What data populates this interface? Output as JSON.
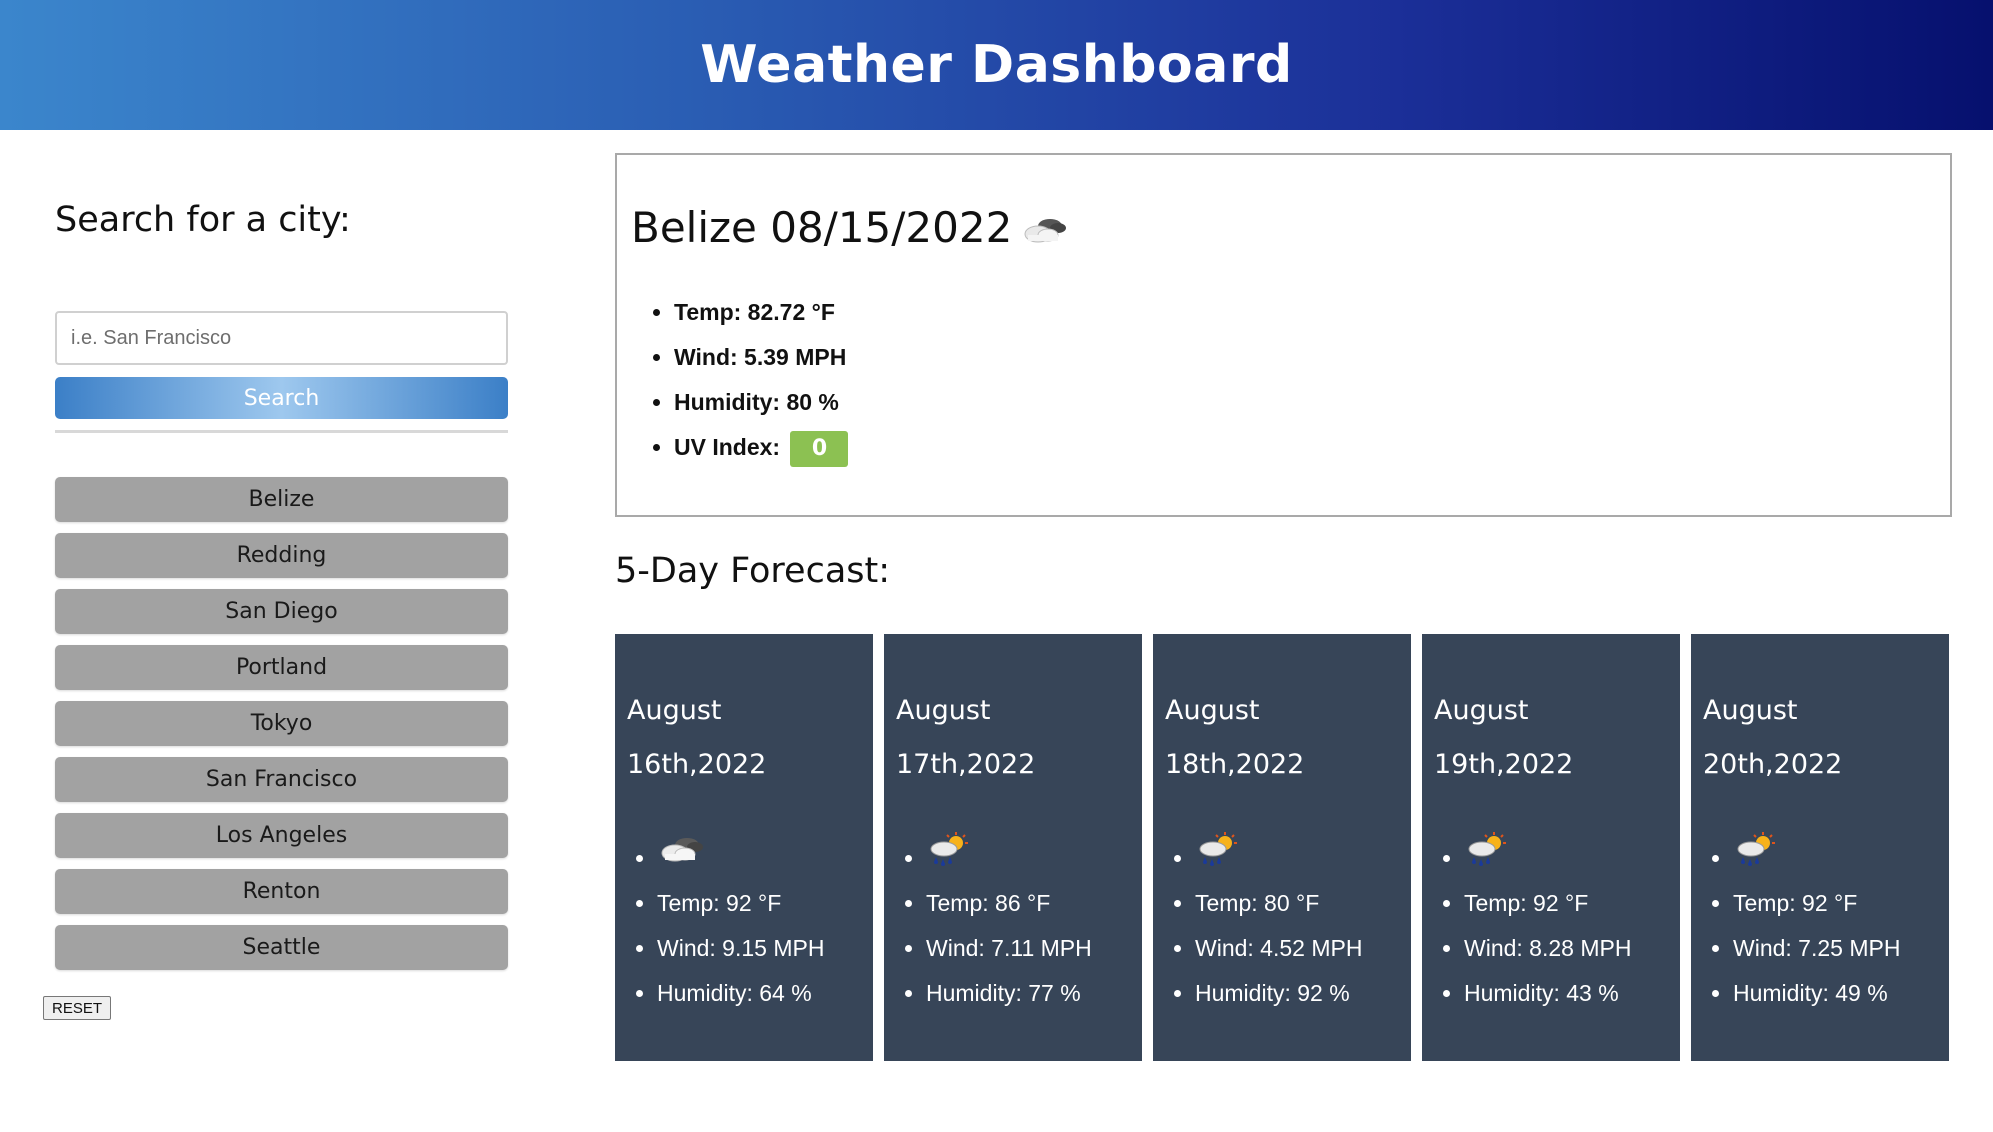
{
  "header": {
    "title": "Weather Dashboard"
  },
  "sidebar": {
    "search_heading": "Search for a city:",
    "search_placeholder": "i.e. San Francisco",
    "search_value": "",
    "search_button": "Search",
    "history": [
      {
        "label": "Belize"
      },
      {
        "label": "Redding"
      },
      {
        "label": "San Diego"
      },
      {
        "label": "Portland"
      },
      {
        "label": "Tokyo"
      },
      {
        "label": "San Francisco"
      },
      {
        "label": "Los Angeles"
      },
      {
        "label": "Renton"
      },
      {
        "label": "Seattle"
      }
    ],
    "reset_button": "RESET"
  },
  "current": {
    "title": "Belize 08/15/2022",
    "icon": "cloudy-icon",
    "temp": "Temp: 82.72 °F",
    "wind": "Wind: 5.39 MPH",
    "humidity": "Humidity: 80 %",
    "uv_label": "UV Index:",
    "uv_value": "0",
    "uv_color": "#8cc152"
  },
  "forecast": {
    "heading": "5-Day Forecast:",
    "card_color": "#374558",
    "days": [
      {
        "date": "August 16th,2022",
        "icon": "cloudy-icon",
        "temp": "Temp: 92 °F",
        "wind": "Wind: 9.15 MPH",
        "humidity": "Humidity: 64 %"
      },
      {
        "date": "August 17th,2022",
        "icon": "rain-sun-icon",
        "temp": "Temp: 86 °F",
        "wind": "Wind: 7.11 MPH",
        "humidity": "Humidity: 77 %"
      },
      {
        "date": "August 18th,2022",
        "icon": "rain-sun-icon",
        "temp": "Temp: 80 °F",
        "wind": "Wind: 4.52 MPH",
        "humidity": "Humidity: 92 %"
      },
      {
        "date": "August 19th,2022",
        "icon": "rain-sun-icon",
        "temp": "Temp: 92 °F",
        "wind": "Wind: 8.28 MPH",
        "humidity": "Humidity: 43 %"
      },
      {
        "date": "August 20th,2022",
        "icon": "rain-sun-icon",
        "temp": "Temp: 92 °F",
        "wind": "Wind: 7.25 MPH",
        "humidity": "Humidity: 49 %"
      }
    ]
  }
}
